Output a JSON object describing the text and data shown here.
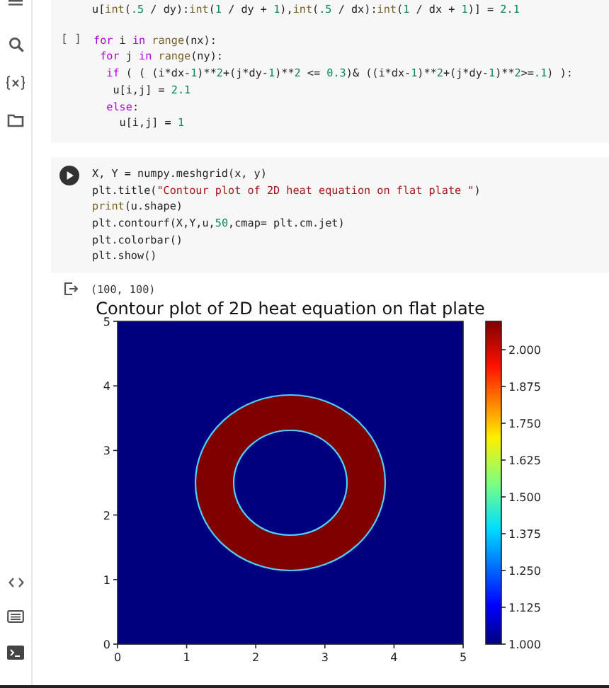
{
  "cell_above": {
    "lines": [
      {
        "tokens": [
          {
            "kind": "plain",
            "text": "u["
          },
          {
            "kind": "fn",
            "text": "int"
          },
          {
            "kind": "plain",
            "text": "("
          },
          {
            "kind": "num",
            "text": ".5"
          },
          {
            "kind": "plain",
            "text": " / dy):"
          },
          {
            "kind": "fn",
            "text": "int"
          },
          {
            "kind": "plain",
            "text": "("
          },
          {
            "kind": "num",
            "text": "1"
          },
          {
            "kind": "plain",
            "text": " / dy + "
          },
          {
            "kind": "num",
            "text": "1"
          },
          {
            "kind": "plain",
            "text": "),"
          },
          {
            "kind": "fn",
            "text": "int"
          },
          {
            "kind": "plain",
            "text": "("
          },
          {
            "kind": "num",
            "text": ".5"
          },
          {
            "kind": "plain",
            "text": " / dx):"
          },
          {
            "kind": "fn",
            "text": "int"
          },
          {
            "kind": "plain",
            "text": "("
          },
          {
            "kind": "num",
            "text": "1"
          },
          {
            "kind": "plain",
            "text": " / dx + "
          },
          {
            "kind": "num",
            "text": "1"
          },
          {
            "kind": "plain",
            "text": ")] = "
          },
          {
            "kind": "num",
            "text": "2.1"
          }
        ]
      }
    ]
  },
  "cells": [
    {
      "kind": "idle",
      "prompt": "[ ]",
      "lines": [
        {
          "tokens": [
            {
              "kind": "kw",
              "text": "for"
            },
            {
              "kind": "plain",
              "text": " i "
            },
            {
              "kind": "kw",
              "text": "in"
            },
            {
              "kind": "fn",
              "text": " range"
            },
            {
              "kind": "plain",
              "text": "(nx):"
            }
          ]
        },
        {
          "tokens": [
            {
              "kind": "kw",
              "text": " for"
            },
            {
              "kind": "plain",
              "text": " j "
            },
            {
              "kind": "kw",
              "text": "in"
            },
            {
              "kind": "fn",
              "text": " range"
            },
            {
              "kind": "plain",
              "text": "(ny):"
            }
          ]
        },
        {
          "tokens": [
            {
              "kind": "kw",
              "text": "  if"
            },
            {
              "kind": "plain",
              "text": " ( ( (i*dx-"
            },
            {
              "kind": "num",
              "text": "1"
            },
            {
              "kind": "plain",
              "text": ")**"
            },
            {
              "kind": "num",
              "text": "2"
            },
            {
              "kind": "plain",
              "text": "+(j*dy-"
            },
            {
              "kind": "num",
              "text": "1"
            },
            {
              "kind": "plain",
              "text": ")**"
            },
            {
              "kind": "num",
              "text": "2"
            },
            {
              "kind": "plain",
              "text": " <= "
            },
            {
              "kind": "num",
              "text": "0.3"
            },
            {
              "kind": "plain",
              "text": ")& ((i*dx-"
            },
            {
              "kind": "num",
              "text": "1"
            },
            {
              "kind": "plain",
              "text": ")**"
            },
            {
              "kind": "num",
              "text": "2"
            },
            {
              "kind": "plain",
              "text": "+(j*dy-"
            },
            {
              "kind": "num",
              "text": "1"
            },
            {
              "kind": "plain",
              "text": ")**"
            },
            {
              "kind": "num",
              "text": "2"
            },
            {
              "kind": "plain",
              "text": ">="
            },
            {
              "kind": "num",
              "text": ".1"
            },
            {
              "kind": "plain",
              "text": ") ):"
            }
          ]
        },
        {
          "tokens": [
            {
              "kind": "plain",
              "text": "   u[i,j] = "
            },
            {
              "kind": "num",
              "text": "2.1"
            }
          ]
        },
        {
          "tokens": [
            {
              "kind": "kw",
              "text": "  else"
            },
            {
              "kind": "plain",
              "text": ":"
            }
          ]
        },
        {
          "tokens": [
            {
              "kind": "plain",
              "text": "    u[i,j] = "
            },
            {
              "kind": "num",
              "text": "1"
            }
          ]
        }
      ]
    },
    {
      "kind": "run",
      "lines": [
        {
          "tokens": [
            {
              "kind": "plain",
              "text": "X, Y = numpy.meshgrid(x, y)"
            }
          ]
        },
        {
          "tokens": [
            {
              "kind": "plain",
              "text": "plt.title("
            },
            {
              "kind": "str",
              "text": "\"Contour plot of 2D heat equation on flat plate \""
            },
            {
              "kind": "plain",
              "text": ")"
            }
          ]
        },
        {
          "tokens": [
            {
              "kind": "fn",
              "text": "print"
            },
            {
              "kind": "plain",
              "text": "(u.shape)"
            }
          ]
        },
        {
          "tokens": [
            {
              "kind": "plain",
              "text": "plt.contourf(X,Y,u,"
            },
            {
              "kind": "num",
              "text": "50"
            },
            {
              "kind": "plain",
              "text": ",cmap= plt.cm.jet)"
            }
          ]
        },
        {
          "tokens": [
            {
              "kind": "plain",
              "text": "plt.colorbar()"
            }
          ]
        },
        {
          "tokens": [
            {
              "kind": "plain",
              "text": "plt.show()"
            }
          ]
        }
      ]
    }
  ],
  "output": {
    "text": "(100, 100)",
    "plot": {
      "title": "Contour plot of 2D heat equation on flat plate",
      "xticks": [
        "0",
        "1",
        "2",
        "3",
        "4",
        "5"
      ],
      "yticks": [
        "5",
        "4",
        "3",
        "2",
        "1",
        "0"
      ],
      "colorbar_ticks": [
        "2.000",
        "1.875",
        "1.750",
        "1.625",
        "1.500",
        "1.375",
        "1.250",
        "1.125",
        "1.000"
      ]
    }
  }
}
